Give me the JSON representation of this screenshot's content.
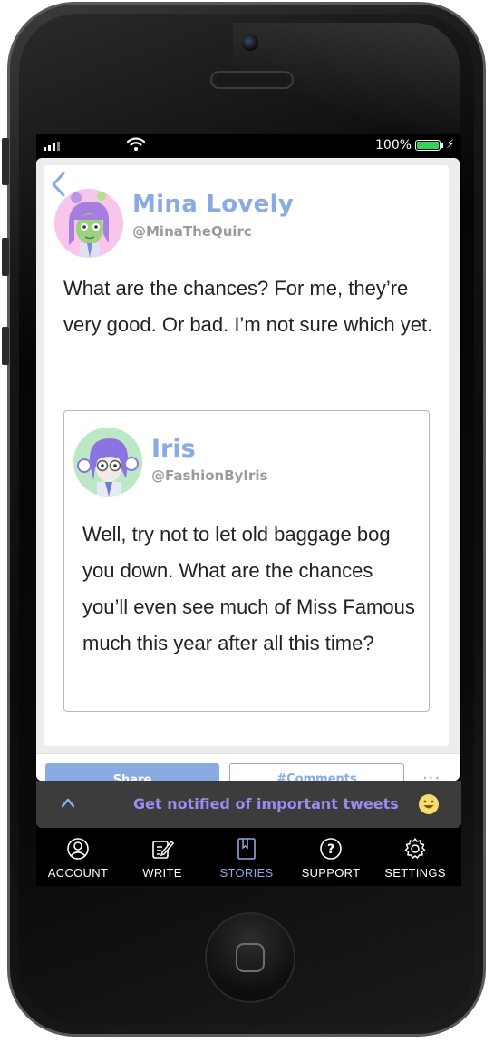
{
  "status_bar": {
    "battery_percent": "100%",
    "battery_level": 1.0,
    "signal_bars": 4,
    "battery_color": "#35d05a"
  },
  "colors": {
    "accent": "#8aaae2",
    "notify_text": "#9b8cf0",
    "notify_bg": "#3c3c3c"
  },
  "header": {
    "back_icon": "chevron-left-icon"
  },
  "tweet": {
    "author_name": "Mina Lovely",
    "author_handle": "@MinaTheQuirc",
    "avatar": "mina-avatar",
    "text": "What are the chances? For me, they’re very good. Or bad. I’m not sure which yet."
  },
  "quoted_tweet": {
    "author_name": "Iris",
    "author_handle": "@FashionByIris",
    "avatar": "iris-avatar",
    "text": "Well, try not to let old baggage bog you down. What are the chances you’ll even see much of Miss Famous much this year after all this time?"
  },
  "actions": {
    "share_label": "Share",
    "comments_label": "#Comments",
    "more_label": "···"
  },
  "notify": {
    "label": "Get notified of important tweets",
    "icon": "smiley-icon"
  },
  "tabbar": {
    "items": [
      {
        "label": "ACCOUNT",
        "icon": "user-icon"
      },
      {
        "label": "WRITE",
        "icon": "pencil-icon"
      },
      {
        "label": "STORIES",
        "icon": "book-icon",
        "active": true
      },
      {
        "label": "SUPPORT",
        "icon": "question-icon"
      },
      {
        "label": "SETTINGS",
        "icon": "gear-icon"
      }
    ]
  }
}
